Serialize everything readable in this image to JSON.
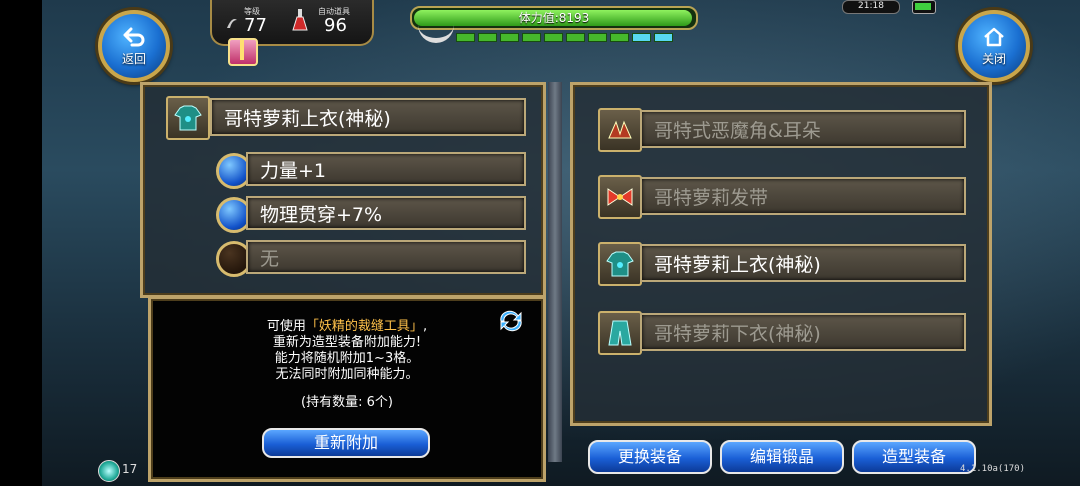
{
  "hud": {
    "back_label": "返回",
    "close_label": "关闭",
    "level_label": "等级",
    "level_value": "77",
    "potion_label": "自动道具",
    "potion_value": "96",
    "stamina_text": "体力值:8193",
    "clock": "21:18"
  },
  "left": {
    "item_name": "哥特萝莉上衣(神秘)",
    "abilities": [
      {
        "text": "力量+1",
        "state": "filled"
      },
      {
        "text": "物理贯穿+7%",
        "state": "filled"
      },
      {
        "text": "无",
        "state": "empty"
      }
    ]
  },
  "info": {
    "line1_pre": "可使用",
    "line1_item": "「妖精的裁缝工具」",
    "line1_post": ",",
    "line2": "重新为造型装备附加能力!",
    "line3": "能力将随机附加1~3格。",
    "line4": "无法同时附加同种能力。",
    "line5": "(持有数量: 6个)",
    "button": "重新附加"
  },
  "right": {
    "items": [
      {
        "name": "哥特式恶魔角&耳朵",
        "active": false
      },
      {
        "name": "哥特萝莉发带",
        "active": false
      },
      {
        "name": "哥特萝莉上衣(神秘)",
        "active": true
      },
      {
        "name": "哥特萝莉下衣(神秘)",
        "active": false
      }
    ]
  },
  "bottom": {
    "btn_change": "更换装备",
    "btn_edit": "编辑锻晶",
    "btn_style": "造型装备",
    "mini_num": "17",
    "version": "4.1.10a(170)"
  },
  "colors": {
    "gold_border": "#bda36a",
    "button_blue": "#1a5fd6",
    "highlight_orange": "#ffc14a"
  }
}
